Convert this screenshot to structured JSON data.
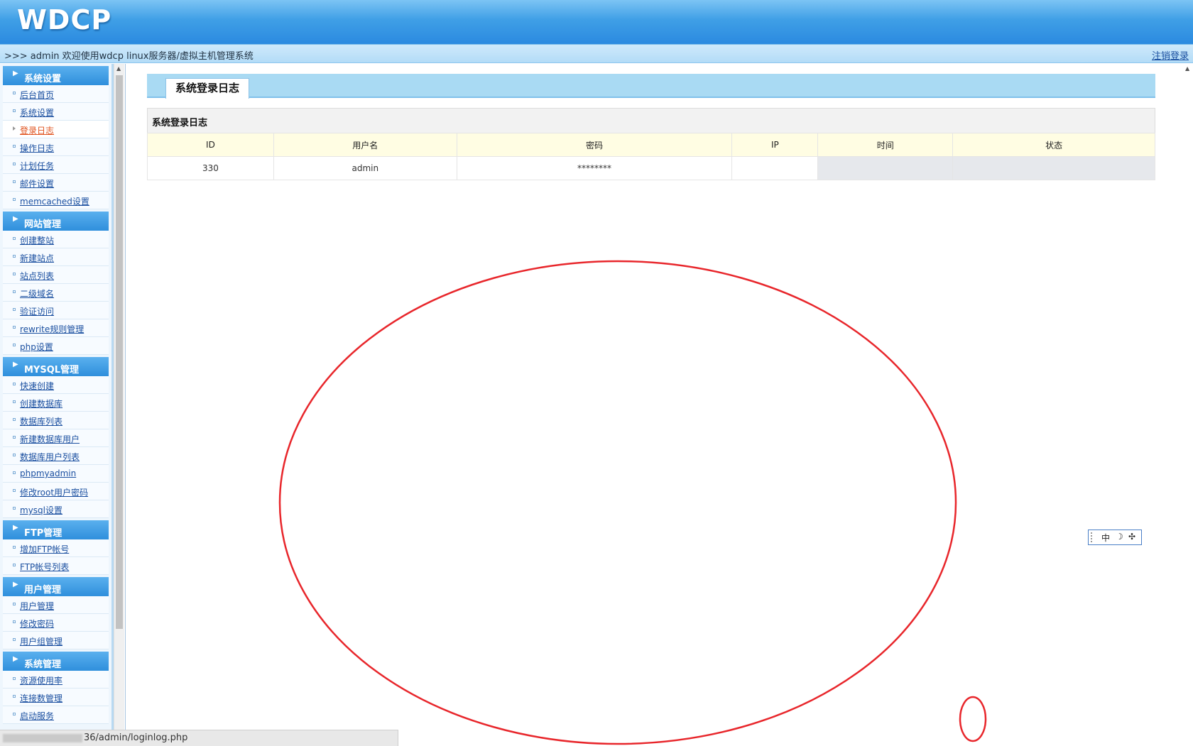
{
  "header": {
    "logo": "WDCP"
  },
  "topbar": {
    "welcome": ">>> admin 欢迎使用wdcp linux服务器/虚拟主机管理系统",
    "logout": "注销登录"
  },
  "sidebar": {
    "groups": [
      {
        "title": "系统设置",
        "items": [
          "后台首页",
          "系统设置",
          "登录日志",
          "操作日志",
          "计划任务",
          "邮件设置",
          "memcached设置"
        ]
      },
      {
        "title": "网站管理",
        "items": [
          "创建整站",
          "新建站点",
          "站点列表",
          "二级域名",
          "验证访问",
          "rewrite规则管理",
          "php设置"
        ]
      },
      {
        "title": "MYSQL管理",
        "items": [
          "快速创建",
          "创建数据库",
          "数据库列表",
          "新建数据库用户",
          "数据库用户列表",
          "phpmyadmin",
          "修改root用户密码",
          "mysql设置"
        ]
      },
      {
        "title": "FTP管理",
        "items": [
          "增加FTP帐号",
          "FTP帐号列表"
        ]
      },
      {
        "title": "用户管理",
        "items": [
          "用户管理",
          "修改密码",
          "用户组管理"
        ]
      },
      {
        "title": "系统管理",
        "items": [
          "资源使用率",
          "连接数管理",
          "启动服务"
        ]
      }
    ],
    "active_item": "登录日志"
  },
  "main": {
    "tab_title": "系统登录日志",
    "table": {
      "caption": "系统登录日志",
      "columns": [
        "ID",
        "用户名",
        "密码",
        "IP",
        "时间",
        "状态"
      ],
      "rows": [
        {
          "id": "330",
          "username": "admin",
          "password": "********",
          "ip": "",
          "time": "",
          "status": ""
        }
      ]
    }
  },
  "ime": {
    "mode": "中",
    "moon": "☽",
    "punct": "✣"
  },
  "statusbar": {
    "url": "36/admin/loginlog.php"
  },
  "colors": {
    "header": "#2b8ae0",
    "sidebar_group": "#3f9fe6",
    "link": "#1a4fa0",
    "active_link": "#e0531f",
    "annotation": "#e8262b"
  }
}
